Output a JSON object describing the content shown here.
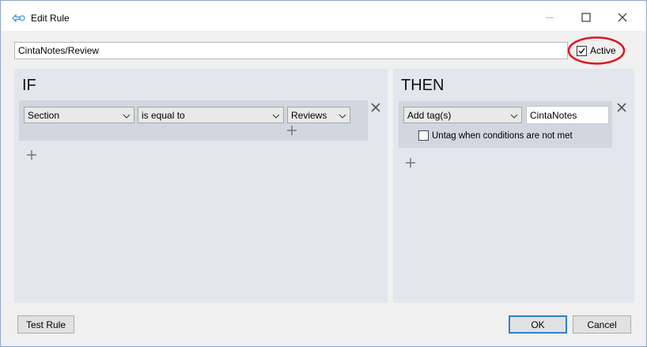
{
  "window": {
    "title": "Edit Rule",
    "icons": {
      "app": "rule-icon",
      "minimize": "minimize-icon",
      "maximize": "maximize-icon",
      "close": "close-icon"
    }
  },
  "rule": {
    "name": "CintaNotes/Review",
    "active_label": "Active",
    "active_checked": true,
    "highlight_color": "#e0141b"
  },
  "if_panel": {
    "heading": "IF",
    "condition": {
      "field": "Section",
      "operator": "is equal to",
      "value": "Reviews"
    }
  },
  "then_panel": {
    "heading": "THEN",
    "action": {
      "type": "Add tag(s)",
      "tag": "CintaNotes",
      "untag_label": "Untag when conditions are not met",
      "untag_checked": false
    }
  },
  "footer": {
    "test_label": "Test Rule",
    "ok_label": "OK",
    "cancel_label": "Cancel"
  },
  "colors": {
    "panel_bg": "#e3e6ec",
    "row_bg": "#d2d6df",
    "accent": "#2f7fd0"
  }
}
